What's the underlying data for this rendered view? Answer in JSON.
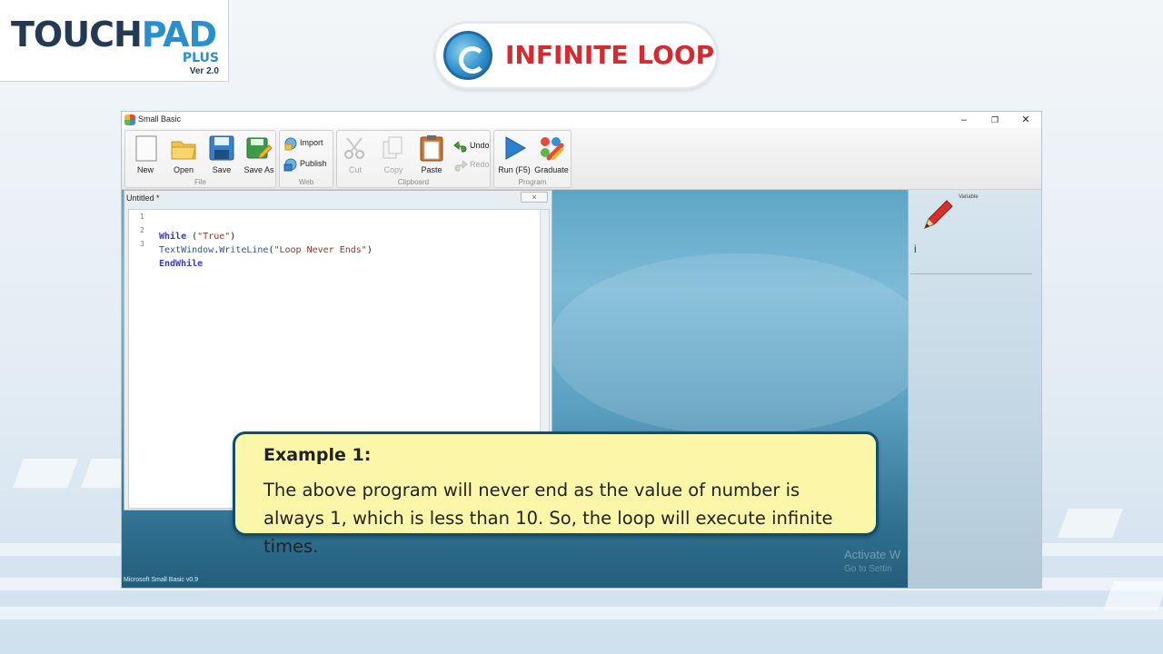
{
  "branding": {
    "logo_prefix": "TOUCH",
    "logo_suffix": "PAD",
    "logo_plus": "PLUS",
    "logo_version": "Ver 2.0"
  },
  "lesson_title": "INFINITE LOOP",
  "window": {
    "title": "Small Basic",
    "controls": {
      "minimize": "–",
      "restore": "❐",
      "close": "✕"
    }
  },
  "ribbon": {
    "file_group": {
      "label": "File",
      "new": "New",
      "open": "Open",
      "save": "Save",
      "save_as": "Save As"
    },
    "web_group": {
      "label": "Web",
      "import": "Import",
      "publish": "Publish"
    },
    "clipboard_group": {
      "label": "Clipboard",
      "cut": "Cut",
      "copy": "Copy",
      "paste": "Paste",
      "undo": "Undo",
      "redo": "Redo"
    },
    "program_group": {
      "label": "Program",
      "run": "Run (F5)",
      "graduate": "Graduate"
    }
  },
  "document": {
    "title": "Untitled *",
    "close": "×",
    "lines": [
      {
        "num": "1",
        "kw1": "While",
        "rest": " (",
        "str": "\"True\"",
        "end": ")"
      },
      {
        "num": "2",
        "obj": "TextWindow",
        "dot": ".",
        "method": "WriteLine",
        "open": "(",
        "str": "\"Loop Never Ends\"",
        "end": ")"
      },
      {
        "num": "3",
        "kw1": "EndWhile"
      }
    ]
  },
  "statusbar": "Microsoft Small Basic v0.9",
  "right_panel": {
    "label": "Variable",
    "cursor": "i"
  },
  "watermark": {
    "line1": "Activate W",
    "line2": "Go to Settin"
  },
  "callout": {
    "heading": "Example 1:",
    "body": "The above program will never end as the value of number is always 1, which is less than 10. So, the loop will execute infinite times."
  },
  "colors": {
    "brand_dark": "#243a54",
    "brand_blue": "#2a8fcf",
    "title_red": "#d32b30",
    "callout_bg": "#fbf6a8",
    "callout_border": "#0f4f6e"
  }
}
